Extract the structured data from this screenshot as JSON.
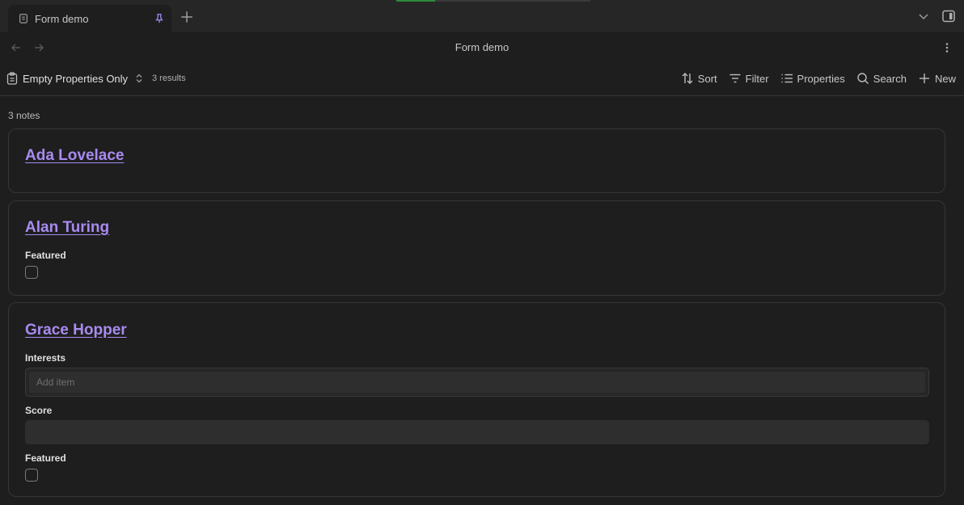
{
  "tab": {
    "title": "Form demo"
  },
  "nav": {
    "title": "Form demo"
  },
  "toolbar": {
    "view_name": "Empty Properties Only",
    "results": "3 results",
    "sort": "Sort",
    "filter": "Filter",
    "properties": "Properties",
    "search": "Search",
    "new": "New"
  },
  "main": {
    "count": "3 notes",
    "cards": [
      {
        "name": "Ada Lovelace"
      },
      {
        "name": "Alan Turing",
        "featured_label": "Featured",
        "featured_checked": false
      },
      {
        "name": "Grace Hopper",
        "interests_label": "Interests",
        "interests_placeholder": "Add item",
        "score_label": "Score",
        "score_value": "",
        "featured_label": "Featured",
        "featured_checked": false
      }
    ]
  },
  "colors": {
    "background": "#1e1e1e",
    "link": "#a88bf0",
    "pin_accent": "#a78bfa"
  }
}
